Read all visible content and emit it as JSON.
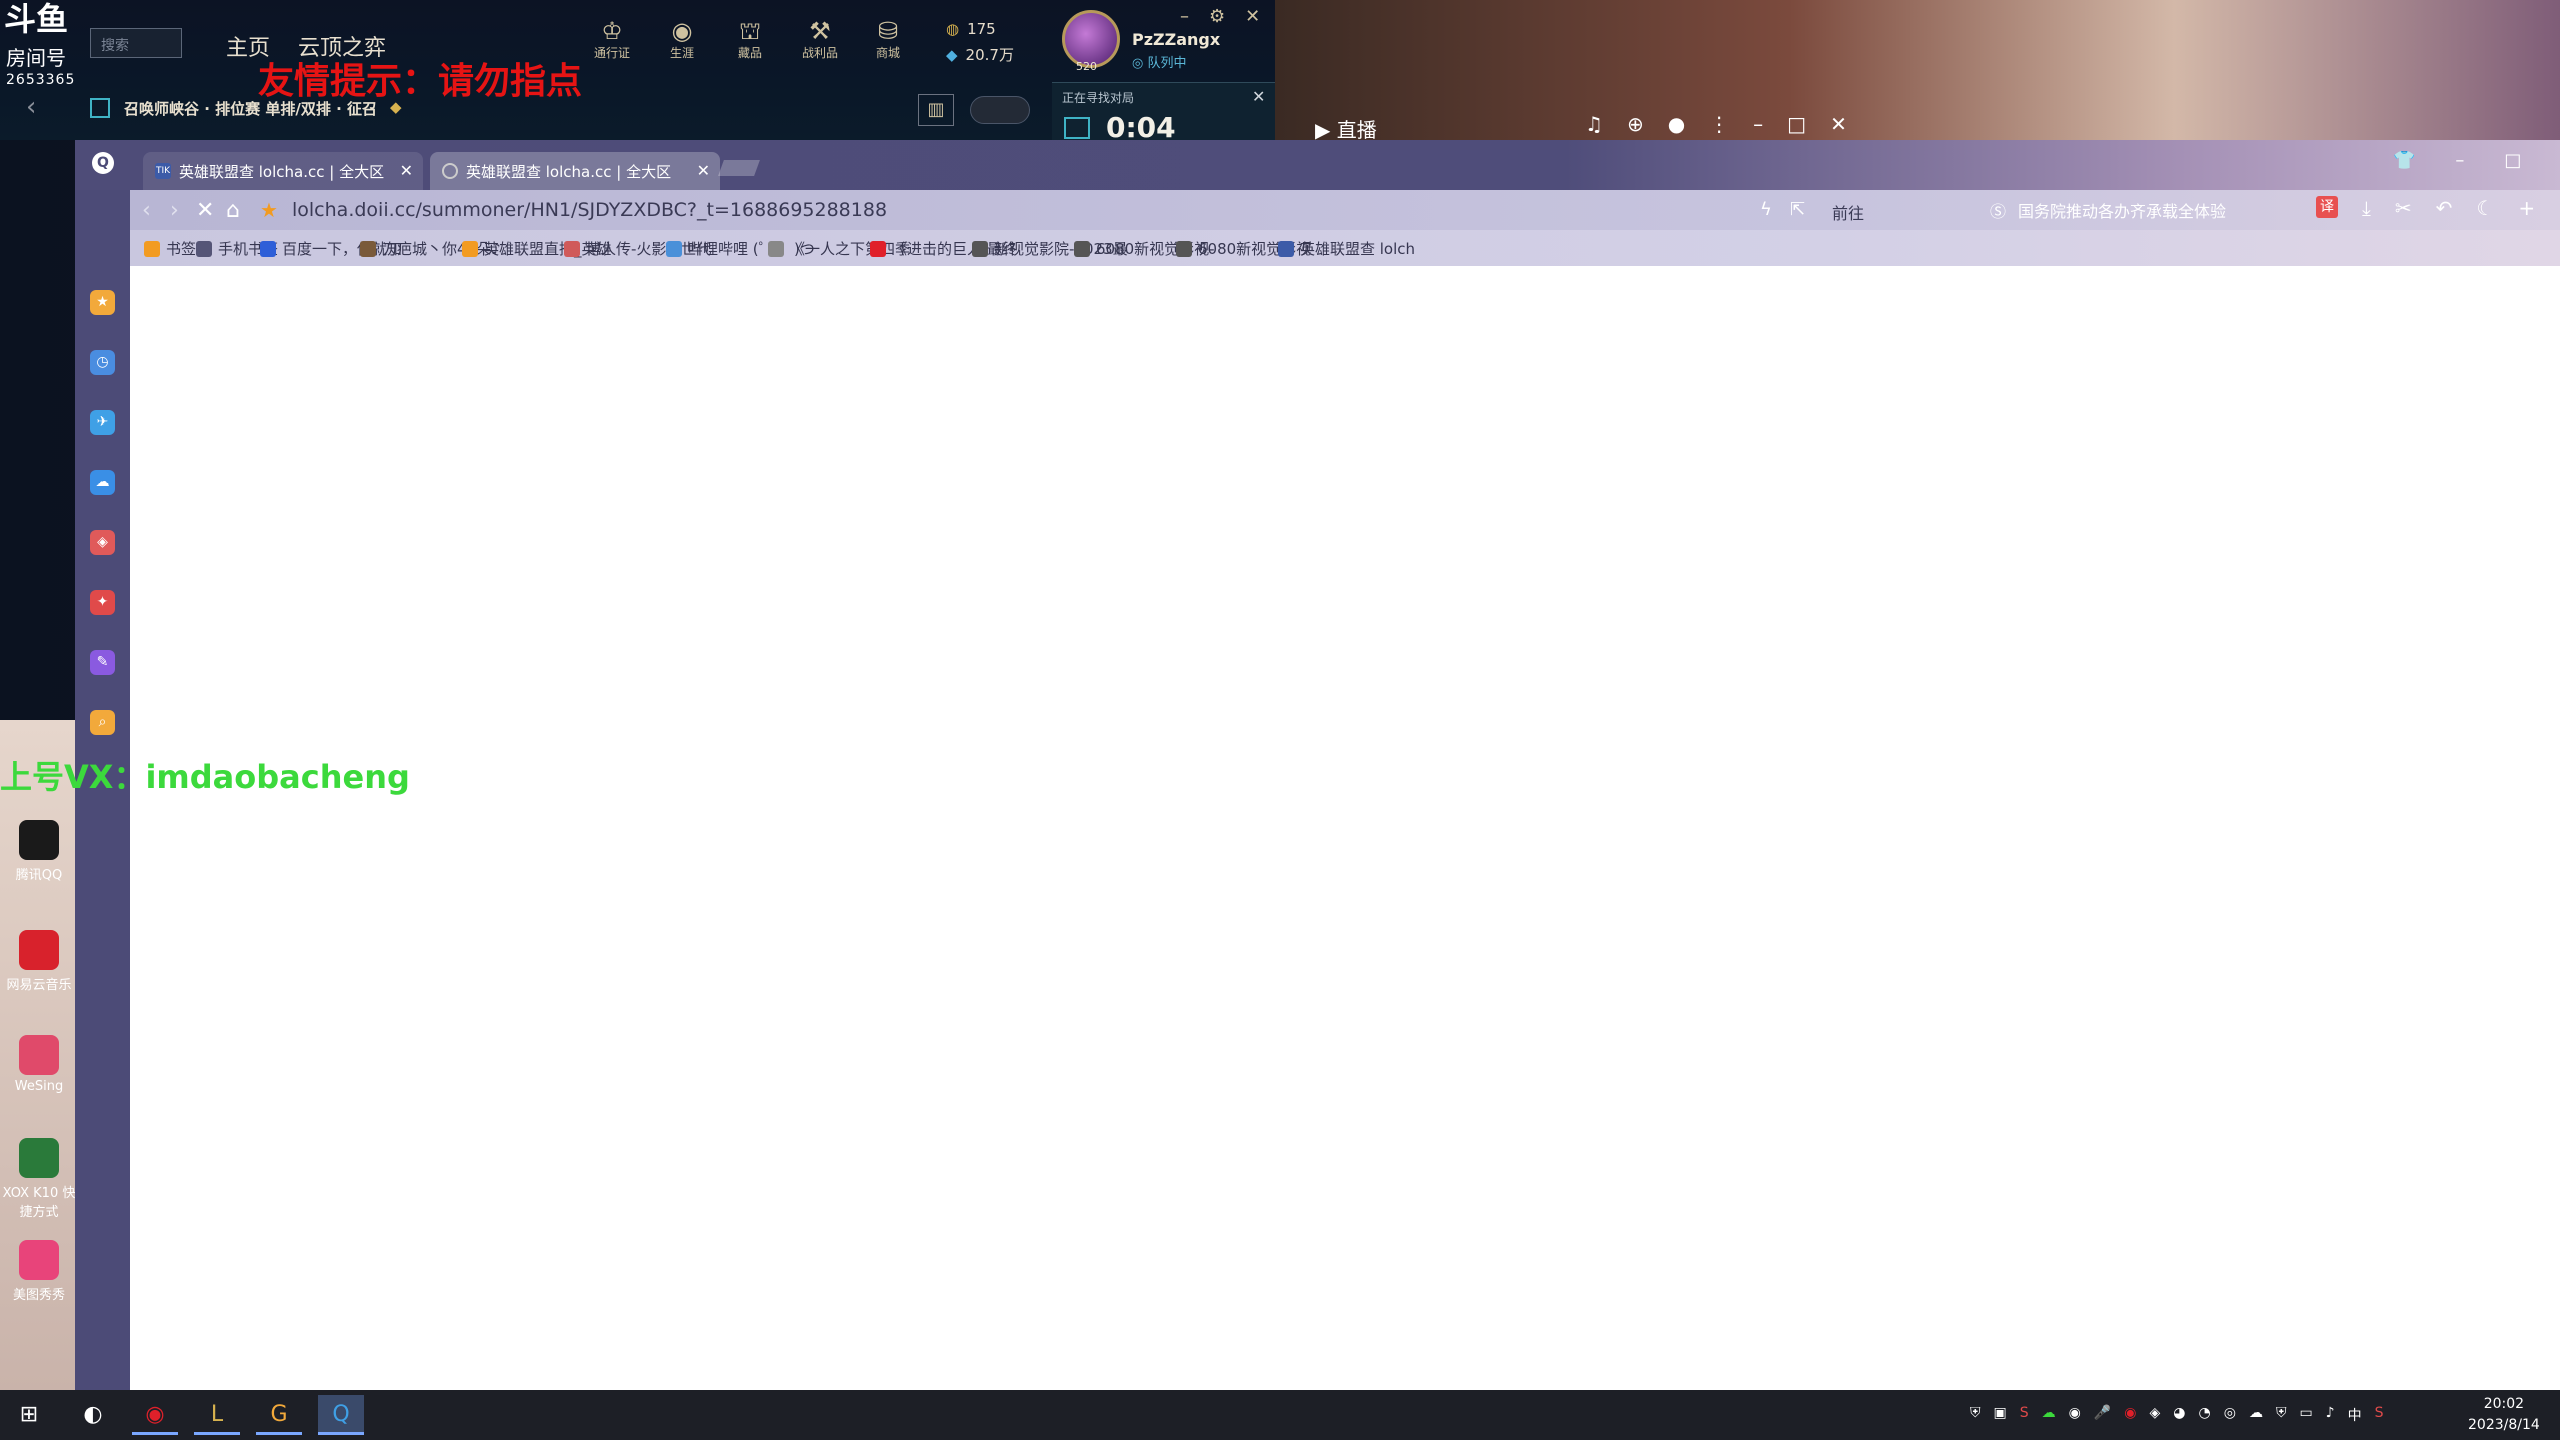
{
  "lol": {
    "logo_text": "斗鱼",
    "room_label": "房间号",
    "room_number": "2653365",
    "search_placeholder": "搜索",
    "nav_home": "主页",
    "nav_tft": "云顶之弈",
    "icons": [
      {
        "label": "通行证",
        "icon": "pass-icon"
      },
      {
        "label": "生涯",
        "icon": "profile-icon"
      },
      {
        "label": "藏品",
        "icon": "collection-icon"
      },
      {
        "label": "战利品",
        "icon": "loot-icon"
      },
      {
        "label": "商城",
        "icon": "store-icon"
      }
    ],
    "currency_rp": "175",
    "currency_be": "20.7万",
    "summoner_name": "PzZZangx",
    "summoner_status": "队列中",
    "level_badge": "520",
    "warning_text": "友情提示：请勿指点",
    "game_mode": "召唤师峡谷 · 排位赛 单排/双排 · 征召",
    "queue_label": "正在寻找对局",
    "queue_time": "0:04"
  },
  "stream": {
    "live_label": "直播"
  },
  "browser": {
    "tabs": [
      {
        "label": "英雄联盟查 lolcha.cc | 全大区",
        "active": false
      },
      {
        "label": "英雄联盟查 lolcha.cc | 全大区",
        "active": true
      }
    ],
    "url": "lolcha.doii.cc/summoner/HN1/SJDYZXDBC?_t=1688695288188",
    "goto_label": "前往",
    "search_text": "国务院推动各办齐承载全体验",
    "translate_label": "译",
    "bookmarks": [
      {
        "label": "书签",
        "color": "#f29b21"
      },
      {
        "label": "手机书签",
        "color": "#555577"
      },
      {
        "label": "百度一下，你就知",
        "color": "#2e5fd8"
      },
      {
        "label": "刀疤城丶你41朵♪",
        "color": "#7a5a3a"
      },
      {
        "label": "英雄联盟直播_英雄",
        "color": "#f29b21"
      },
      {
        "label": "博人传-火影次世代",
        "color": "#d05a5a"
      },
      {
        "label": "哔哩哔哩 (゜-゜)つ",
        "color": "#4a90d9"
      },
      {
        "label": "《一人之下第四季",
        "color": "#888888"
      },
      {
        "label": "《进击的巨人 最终",
        "color": "#e0202a"
      },
      {
        "label": "新视觉影院-2023最",
        "color": "#555555"
      },
      {
        "label": "6080新视觉影视-",
        "color": "#555555"
      },
      {
        "label": "6080新视觉影视",
        "color": "#555555"
      },
      {
        "label": "英雄联盟查 lolch",
        "color": "#3c5ba8"
      }
    ]
  },
  "overlay": {
    "vx_text": "上号VX：imdaobacheng"
  },
  "desktop_icons": [
    {
      "label": "腾讯QQ",
      "color": "#1a1a1a"
    },
    {
      "label": "网易云音乐",
      "color": "#d8222c"
    },
    {
      "label": "WeSing",
      "color": "#e04a6a"
    },
    {
      "label": "XOX K10 快捷方式",
      "color": "#2a7a3a"
    },
    {
      "label": "美图秀秀",
      "color": "#e8447a"
    }
  ],
  "taskbar": {
    "clock_time": "20:02",
    "clock_date": "2023/8/14",
    "ime_label": "中"
  }
}
